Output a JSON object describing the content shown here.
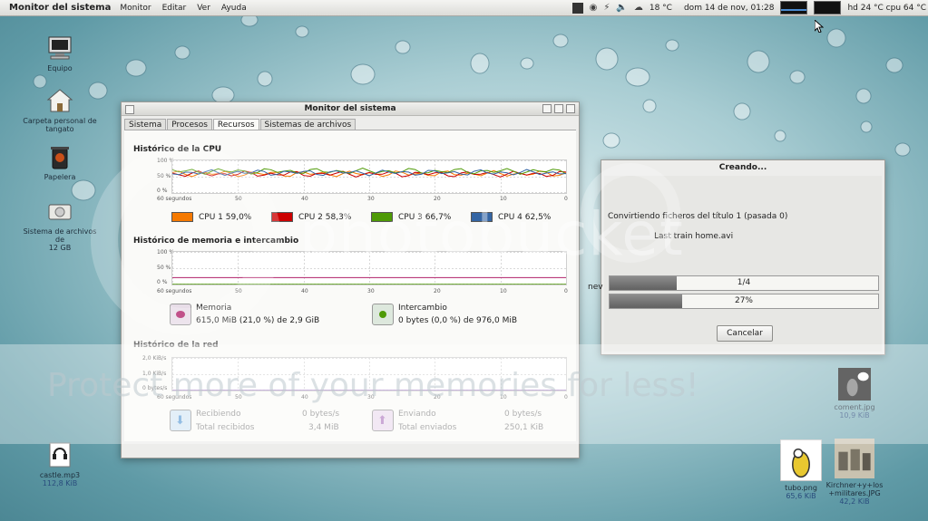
{
  "top_panel": {
    "app_title": "Monitor del sistema",
    "menus": [
      "Monitor",
      "Editar",
      "Ver",
      "Ayuda"
    ],
    "temperature": "18 °C",
    "datetime": "dom 14 de nov, 01:28",
    "hd_cpu_temp": "hd 24 °C cpu 64 °C"
  },
  "desktop_icons": [
    {
      "label": "Equipo",
      "sub": "",
      "icon": "computer-icon"
    },
    {
      "label": "Carpeta personal de tangato",
      "sub": "",
      "icon": "home-folder-icon"
    },
    {
      "label": "Papelera",
      "sub": "",
      "icon": "trash-icon"
    },
    {
      "label": "Sistema de archivos de",
      "sub": "12 GB",
      "icon": "harddisk-icon"
    },
    {
      "label": "castle.mp3",
      "sub": "112,8 KiB",
      "icon": "audio-file-icon"
    },
    {
      "label": "coment.jpg",
      "sub": "10,9 KiB",
      "icon": "image-file-icon"
    },
    {
      "label": "tubo.png",
      "sub": "65,6 KiB",
      "icon": "image-file-icon"
    },
    {
      "label": "Kirchner+y+los +militares.JPG",
      "sub": "42,2 KiB",
      "icon": "image-file-icon"
    }
  ],
  "monitor_window": {
    "title": "Monitor del sistema",
    "tabs": [
      "Sistema",
      "Procesos",
      "Recursos",
      "Sistemas de archivos"
    ],
    "active_tab": "Recursos",
    "cpu": {
      "title": "Histórico de la CPU",
      "y_ticks": [
        "100 %",
        "50 %",
        "0 %"
      ],
      "x_ticks": [
        "60 segundos",
        "50",
        "40",
        "30",
        "20",
        "10",
        "0"
      ],
      "legend": [
        {
          "label": "CPU 1",
          "value": "59,0%",
          "color": "#f57900"
        },
        {
          "label": "CPU 2",
          "value": "58,3%",
          "color": "#cc0000"
        },
        {
          "label": "CPU 3",
          "value": "66,7%",
          "color": "#4e9a06"
        },
        {
          "label": "CPU 4",
          "value": "62,5%",
          "color": "#3465a4"
        }
      ]
    },
    "memory": {
      "title": "Histórico de memoria e intercambio",
      "y_ticks": [
        "100 %",
        "50 %",
        "0 %"
      ],
      "x_ticks": [
        "60 segundos",
        "50",
        "40",
        "30",
        "20",
        "10",
        "0"
      ],
      "mem_label": "Memoria",
      "mem_value": "615,0 MiB (21,0 %) de 2,9 GiB",
      "swap_label": "Intercambio",
      "swap_value": "0 bytes (0,0 %) de 976,0 MiB"
    },
    "network": {
      "title": "Histórico de la red",
      "y_ticks": [
        "2,0 KiB/s",
        "1,0 KiB/s",
        "0 bytes/s"
      ],
      "x_ticks": [
        "60 segundos",
        "50",
        "40",
        "30",
        "20",
        "10",
        "0"
      ],
      "recv_label": "Recibiendo",
      "recv_rate": "0 bytes/s",
      "recv_total_label": "Total recibidos",
      "recv_total": "3,4 MiB",
      "send_label": "Enviando",
      "send_rate": "0 bytes/s",
      "send_total_label": "Total enviados",
      "send_total": "250,1 KiB"
    }
  },
  "dialog": {
    "title": "Creando...",
    "status": "Convirtiendo ficheros del título 1 (pasada 0)",
    "file": "Last train home.avi",
    "progress1_text": "1/4",
    "progress1_fraction": 0.25,
    "progress2_text": "27%",
    "progress2_fraction": 0.27,
    "cancel_label": "Cancelar",
    "side_fragment": "nev"
  },
  "watermark": {
    "logo": "photobucket",
    "text": "Protect more of your memories for less!"
  }
}
